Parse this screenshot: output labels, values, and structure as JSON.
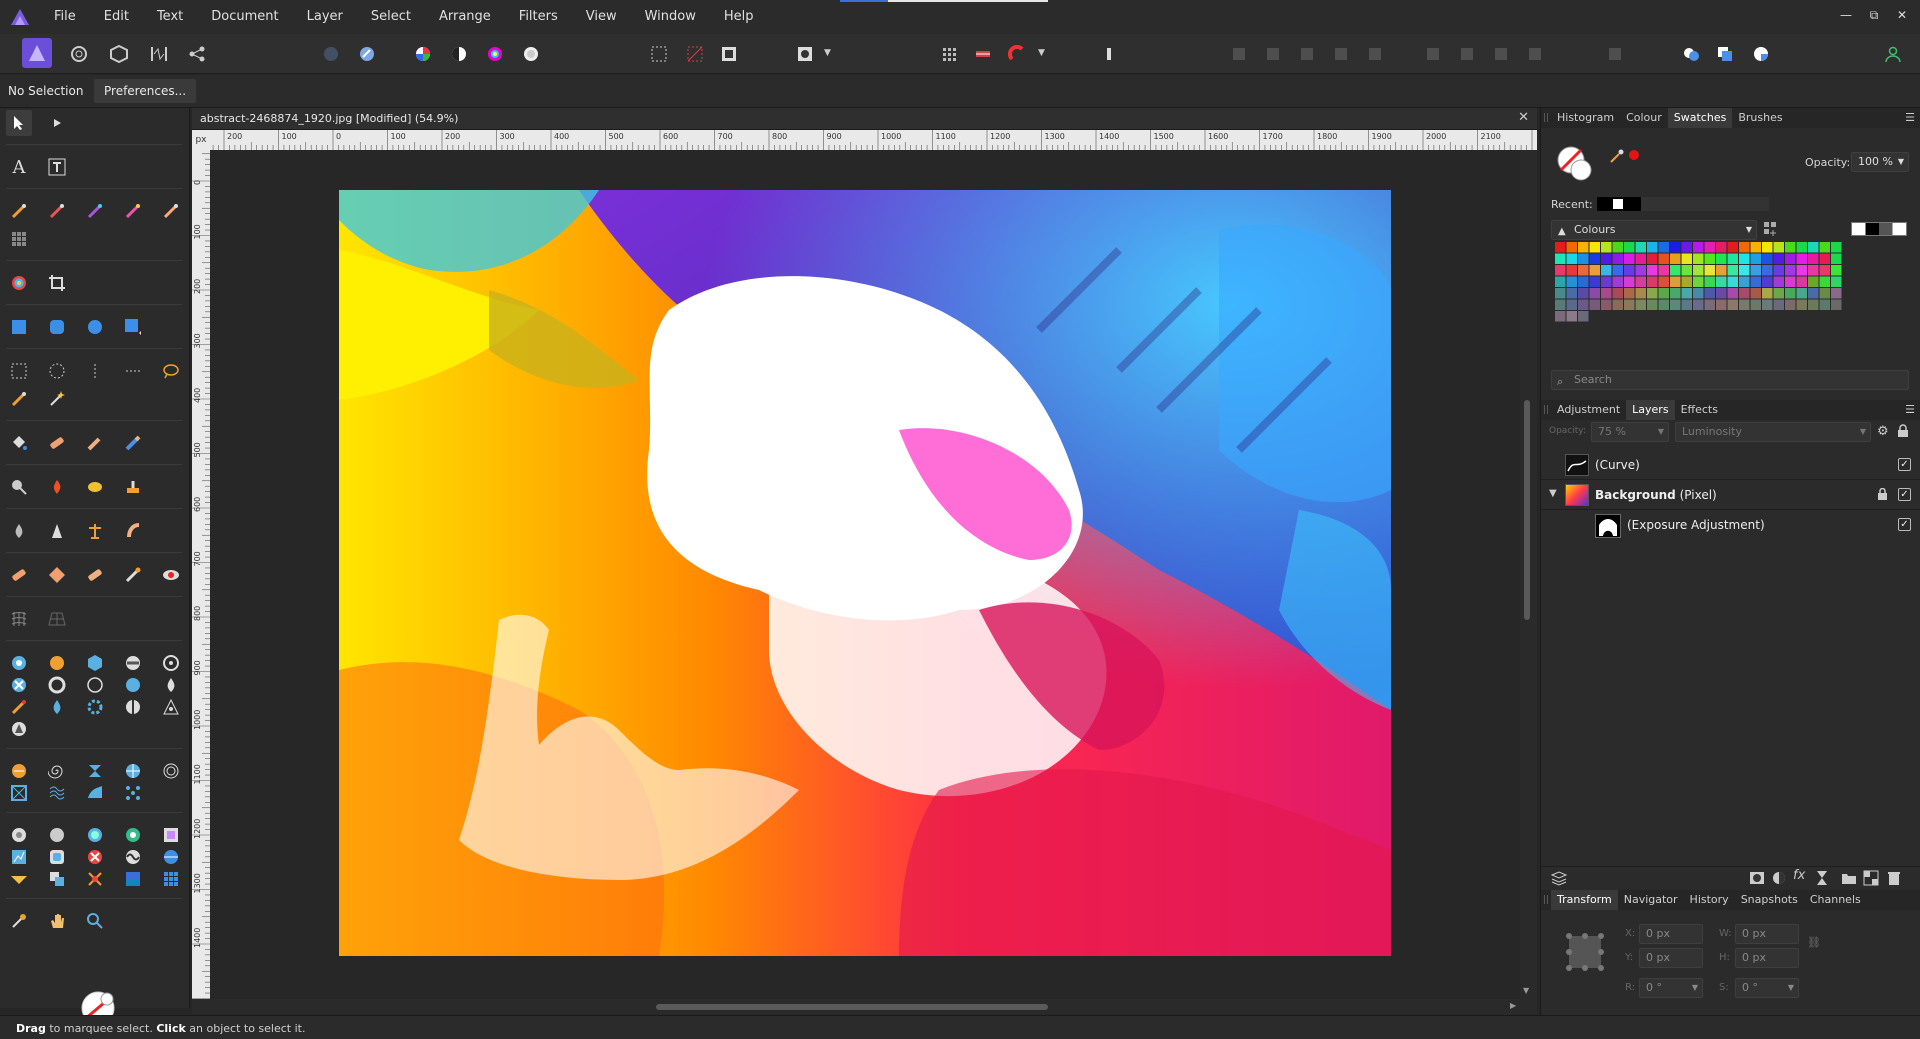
{
  "menu": [
    "File",
    "Edit",
    "Text",
    "Document",
    "Layer",
    "Select",
    "Arrange",
    "Filters",
    "View",
    "Window",
    "Help"
  ],
  "window_controls": {
    "minimize": "—",
    "restore": "⧉",
    "close": "✕"
  },
  "context": {
    "selection": "No Selection",
    "preferences": "Preferences..."
  },
  "document": {
    "title": "abstract-2468874_1920.jpg [Modified] (54.9%)",
    "close": "✕"
  },
  "ruler": {
    "unit": "px",
    "h_labels": [
      "200",
      "100",
      "0",
      "100",
      "200",
      "300",
      "400",
      "500",
      "600",
      "700",
      "800",
      "900",
      "1000",
      "1100",
      "1200",
      "1300",
      "1400",
      "1500",
      "1600",
      "1700",
      "1800",
      "1900",
      "2000",
      "2100"
    ],
    "v_labels": [
      "0",
      "100",
      "200",
      "300",
      "400",
      "500",
      "600",
      "700",
      "800",
      "900",
      "1000",
      "1100",
      "1200",
      "1300",
      "1400"
    ]
  },
  "swatches_panel": {
    "tabs": [
      "Histogram",
      "Colour",
      "Swatches",
      "Brushes"
    ],
    "active": "Swatches",
    "opacity_label": "Opacity:",
    "opacity_value": "100 %",
    "recent_label": "Recent:",
    "palette_name": "Colours",
    "search_placeholder": "Search"
  },
  "layers_panel": {
    "tabs": [
      "Adjustment",
      "Layers",
      "Effects"
    ],
    "active": "Layers",
    "opacity_label": "Opacity:",
    "opacity_value": "75 %",
    "blend_mode": "Luminosity",
    "layers": [
      {
        "name": "(Curve)",
        "bold": "",
        "checked": "✓"
      },
      {
        "name": "(Pixel)",
        "bold": "Background",
        "checked": "✓"
      },
      {
        "name": "(Exposure Adjustment)",
        "bold": "",
        "checked": "✓"
      }
    ]
  },
  "transform_panel": {
    "tabs": [
      "Transform",
      "Navigator",
      "History",
      "Snapshots",
      "Channels"
    ],
    "active": "Transform",
    "x_label": "X:",
    "x_value": "0 px",
    "y_label": "Y:",
    "y_value": "0 px",
    "w_label": "W:",
    "w_value": "0 px",
    "h_label": "H:",
    "h_value": "0 px",
    "r_label": "R:",
    "r_value": "0 °",
    "s_label": "S:",
    "s_value": "0 °"
  },
  "status": {
    "bold1": "Drag",
    "text1": " to marquee select. ",
    "bold2": "Click",
    "text2": " an object to select it."
  },
  "colors": {
    "accent": "#5a46c8",
    "bg": "#2b2b2b",
    "canvas_bg": "#272727"
  }
}
